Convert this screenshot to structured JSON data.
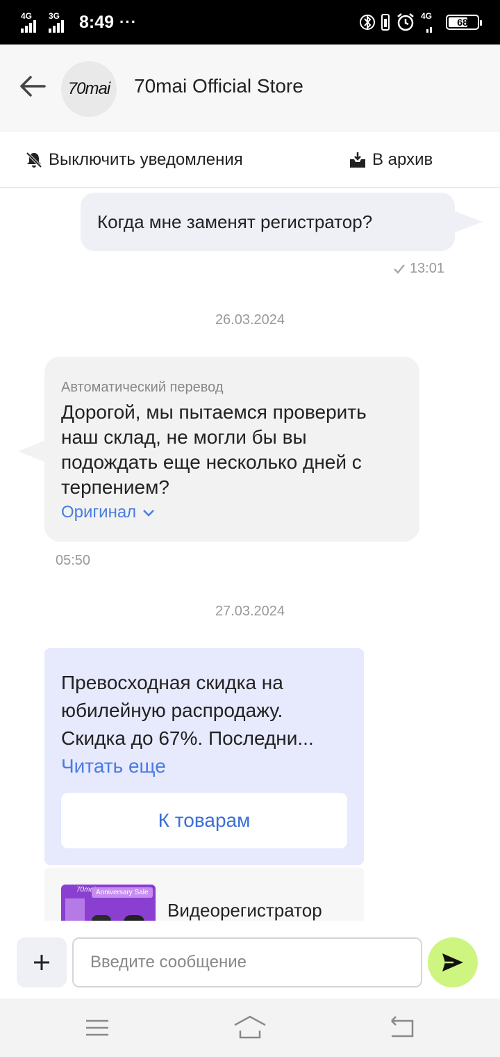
{
  "status_bar": {
    "net1": "4G",
    "net2": "3G",
    "time": "8:49",
    "dots": "···",
    "net3": "4G",
    "battery": "68"
  },
  "header": {
    "back_icon": "arrow-left-icon",
    "logo_text": "70mai",
    "store_name": "70mai Official Store"
  },
  "actions": {
    "mute_label": "Выключить уведомления",
    "archive_label": "В архив"
  },
  "messages": {
    "outgoing": {
      "text": "Когда мне заменят регистратор?",
      "time": "13:01"
    },
    "date1": "26.03.2024",
    "incoming": {
      "auto_label": "Автоматический перевод",
      "text": "Дорогой, мы пытаемся проверить наш склад, не могли бы вы подождать еще несколько дней с терпением?",
      "original_label": "Оригинал",
      "time": "05:50"
    },
    "date2": "27.03.2024",
    "promo": {
      "text": "Превосходная скидка на юбилейную распродажу. Скидка до 67%. Последни...",
      "read_more": "Читать еще",
      "button": "К товарам"
    },
    "product": {
      "thumb_brand": "70mai",
      "thumb_tag": "Anniversary Sale",
      "title": "Видеорегистратор"
    }
  },
  "composer": {
    "placeholder": "Введите сообщение"
  },
  "colors": {
    "accent_link": "#4a7be0",
    "send_button": "#cdf57f",
    "outgoing_bubble": "#eef0f6",
    "promo_card": "#e7e9fd"
  }
}
